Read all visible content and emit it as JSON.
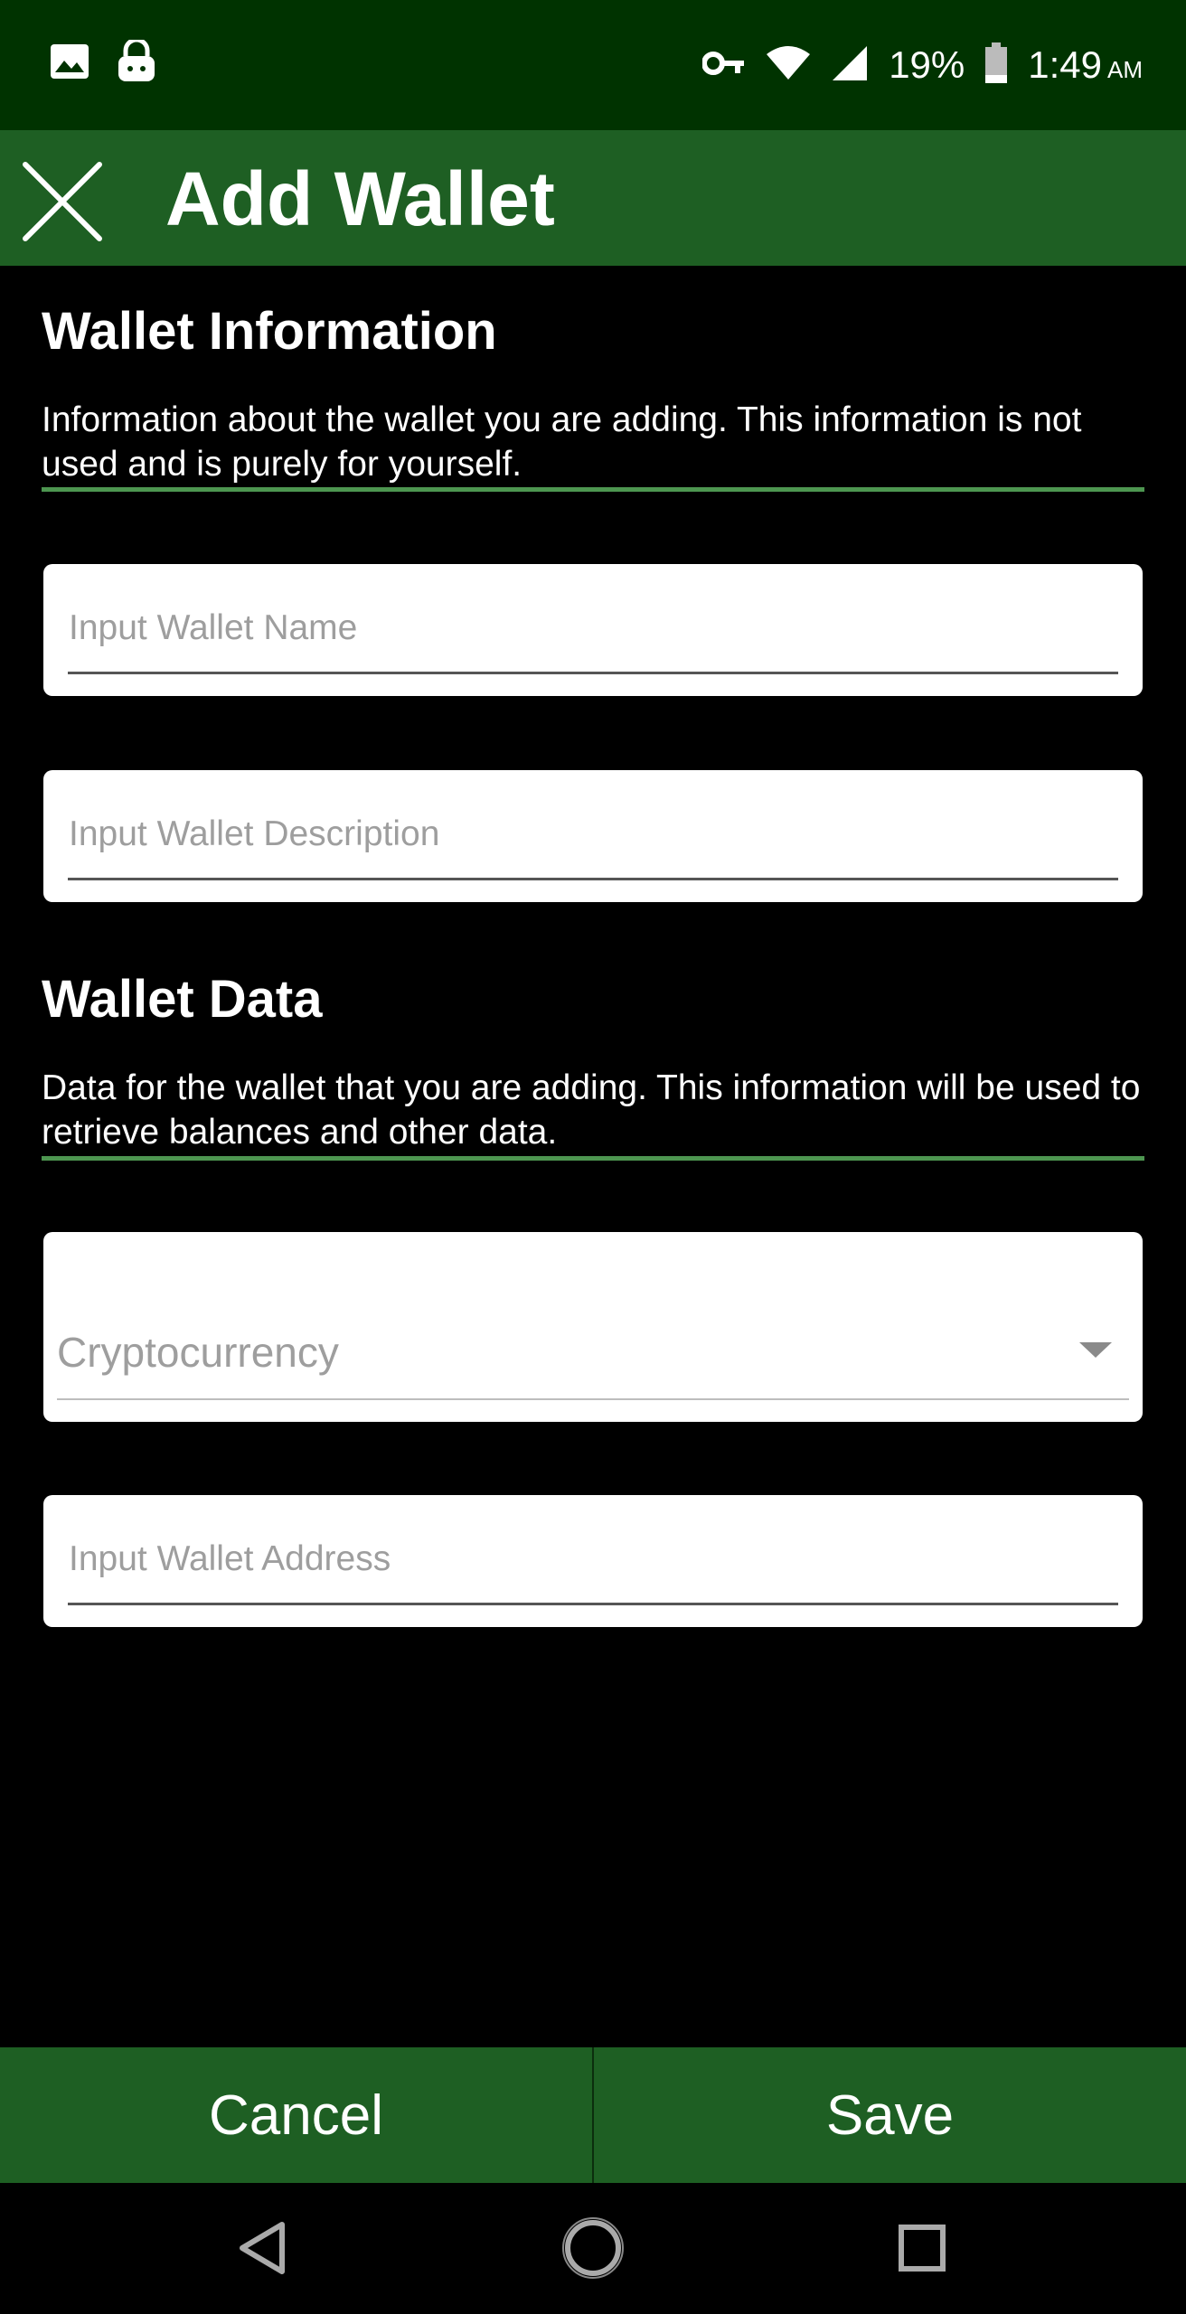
{
  "status_bar": {
    "battery": "19%",
    "time": "1:49",
    "ampm": "AM",
    "icons": [
      "image-icon",
      "vpn-lock-icon",
      "key-icon",
      "wifi-icon",
      "cell-signal-icon",
      "battery-icon"
    ]
  },
  "app_bar": {
    "title": "Add Wallet",
    "close_icon": "close-icon"
  },
  "wallet_info": {
    "title": "Wallet Information",
    "description": "Information about the wallet you are adding. This information is not used and is purely for yourself.",
    "name_placeholder": "Input Wallet Name",
    "description_placeholder": "Input Wallet Description"
  },
  "wallet_data": {
    "title": "Wallet Data",
    "description": "Data for the wallet that you are adding. This information will be used to retrieve balances and other data.",
    "currency_label": "Cryptocurrency",
    "address_placeholder": "Input Wallet Address"
  },
  "actions": {
    "cancel_label": "Cancel",
    "save_label": "Save"
  },
  "nav": {
    "icons": [
      "back-icon",
      "home-icon",
      "recents-icon"
    ]
  },
  "colors": {
    "status_bar": "#003300",
    "app_bar": "#1e5f23",
    "accent_rule": "#4d9650",
    "background": "#000000"
  }
}
